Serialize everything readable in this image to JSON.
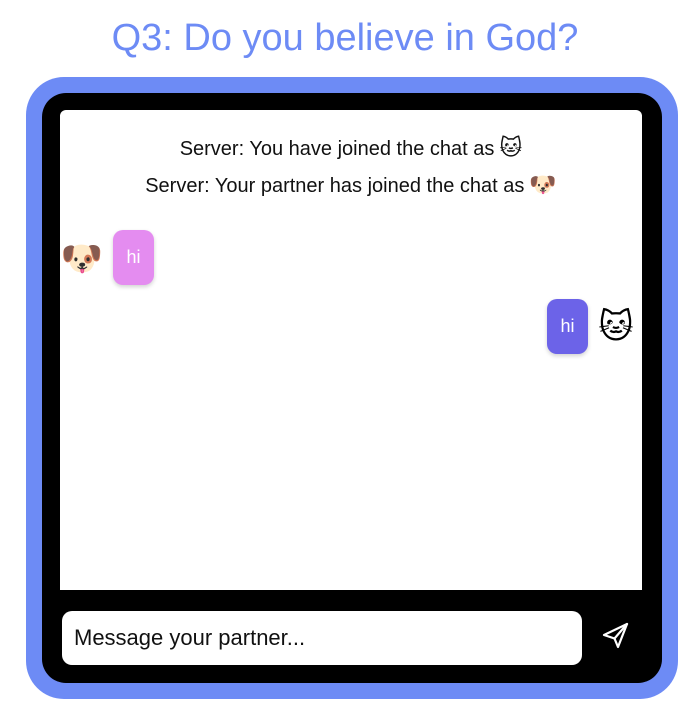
{
  "header": {
    "title": "Q3: Do you believe in God?"
  },
  "chat": {
    "system_messages": [
      {
        "text": "Server: You have joined the chat as",
        "emoji": "🐱"
      },
      {
        "text": "Server: Your partner has joined the chat as",
        "emoji": "🐶"
      }
    ],
    "messages": [
      {
        "sender": "partner",
        "avatar": "🐶",
        "text": "hi",
        "bubble_color": "#e48cf0"
      },
      {
        "sender": "self",
        "avatar": "🐱",
        "text": "hi",
        "bubble_color": "#6c63e8"
      }
    ]
  },
  "composer": {
    "placeholder": "Message your partner...",
    "send_icon": "send-icon"
  },
  "colors": {
    "accent": "#6d8bf5",
    "frame": "#000000",
    "partner_bubble": "#e48cf0",
    "self_bubble": "#6c63e8"
  }
}
